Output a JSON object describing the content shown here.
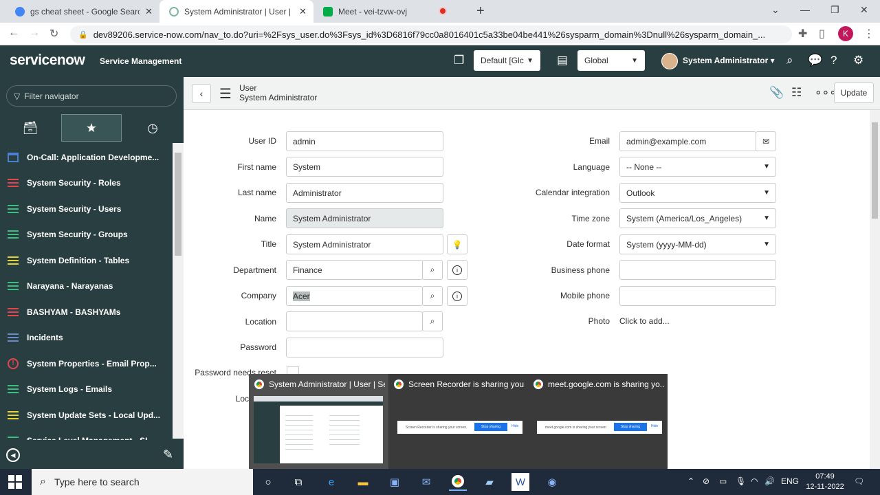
{
  "browser": {
    "tabs": [
      {
        "title": "gs cheat sheet - Google Search",
        "active": false
      },
      {
        "title": "System Administrator | User | Se",
        "active": true
      },
      {
        "title": "Meet - vei-tzvw-ovj",
        "active": false
      }
    ],
    "url": "dev89206.service-now.com/nav_to.do?uri=%2Fsys_user.do%3Fsys_id%3D6816f79cc0a8016401c5a33be04be441%26sysparm_domain%3Dnull%26sysparm_domain_...",
    "profile_initial": "K"
  },
  "header": {
    "logo": "servicenow",
    "subtitle": "Service Management",
    "domain_select": "Default [Glc",
    "scope_select": "Global",
    "user_name": "System Administrator"
  },
  "sidebar": {
    "filter_placeholder": "Filter navigator",
    "items": [
      {
        "label": "On-Call: Application Developme...",
        "icon": "calendar-icon",
        "color": "#4b7fd1"
      },
      {
        "label": "System Security - Roles",
        "icon": "list-icon",
        "color": "#e5434e"
      },
      {
        "label": "System Security - Users",
        "icon": "list-icon",
        "color": "#3fbf7f"
      },
      {
        "label": "System Security - Groups",
        "icon": "list-icon",
        "color": "#3fbf7f"
      },
      {
        "label": "System Definition - Tables",
        "icon": "list-icon",
        "color": "#e8d337"
      },
      {
        "label": "Narayana - Narayanas",
        "icon": "list-icon",
        "color": "#3fbf7f"
      },
      {
        "label": "BASHYAM - BASHYAMs",
        "icon": "list-icon",
        "color": "#e5434e"
      },
      {
        "label": "Incidents",
        "icon": "list-icon",
        "color": "#6b8ac9"
      },
      {
        "label": "System Properties - Email Prop...",
        "icon": "info-icon",
        "color": "#e5434e"
      },
      {
        "label": "System Logs - Emails",
        "icon": "list-icon",
        "color": "#3fbf7f"
      },
      {
        "label": "System Update Sets - Local Upd...",
        "icon": "list-icon",
        "color": "#e8d337"
      },
      {
        "label": "Service Level Management - SL...",
        "icon": "list-icon",
        "color": "#3fbf7f"
      }
    ]
  },
  "form": {
    "record_type": "User",
    "record_name": "System Administrator",
    "update_label": "Update",
    "left_fields": {
      "user_id": {
        "label": "User ID",
        "value": "admin"
      },
      "first_name": {
        "label": "First name",
        "value": "System"
      },
      "last_name": {
        "label": "Last name",
        "value": "Administrator"
      },
      "name": {
        "label": "Name",
        "value": "System Administrator"
      },
      "title": {
        "label": "Title",
        "value": "System Administrator"
      },
      "department": {
        "label": "Department",
        "value": "Finance"
      },
      "company": {
        "label": "Company",
        "value": "Acer"
      },
      "location": {
        "label": "Location",
        "value": ""
      },
      "password": {
        "label": "Password",
        "value": ""
      },
      "password_reset": {
        "label": "Password needs reset"
      },
      "locked": {
        "label": "Loc"
      }
    },
    "right_fields": {
      "email": {
        "label": "Email",
        "value": "admin@example.com"
      },
      "language": {
        "label": "Language",
        "value": "-- None --"
      },
      "calendar": {
        "label": "Calendar integration",
        "value": "Outlook"
      },
      "timezone": {
        "label": "Time zone",
        "value": "System (America/Los_Angeles)"
      },
      "date_format": {
        "label": "Date format",
        "value": "System (yyyy-MM-dd)"
      },
      "business_phone": {
        "label": "Business phone",
        "value": ""
      },
      "mobile_phone": {
        "label": "Mobile phone",
        "value": ""
      },
      "photo": {
        "label": "Photo",
        "value": "Click to add..."
      }
    }
  },
  "preview": {
    "items": [
      {
        "title": "System Administrator | User | Se..."
      },
      {
        "title": "Screen Recorder is sharing your..."
      },
      {
        "title": "meet.google.com is sharing yo..."
      }
    ],
    "bar_text_1": "Screen Recorder is sharing your screen.",
    "bar_text_2": "meet.google.com is sharing your screen",
    "stop_label": "Stop sharing",
    "hide_label": "Hide"
  },
  "taskbar": {
    "search_placeholder": "Type here to search",
    "lang": "ENG",
    "time": "07:49",
    "date": "12-11-2022"
  }
}
